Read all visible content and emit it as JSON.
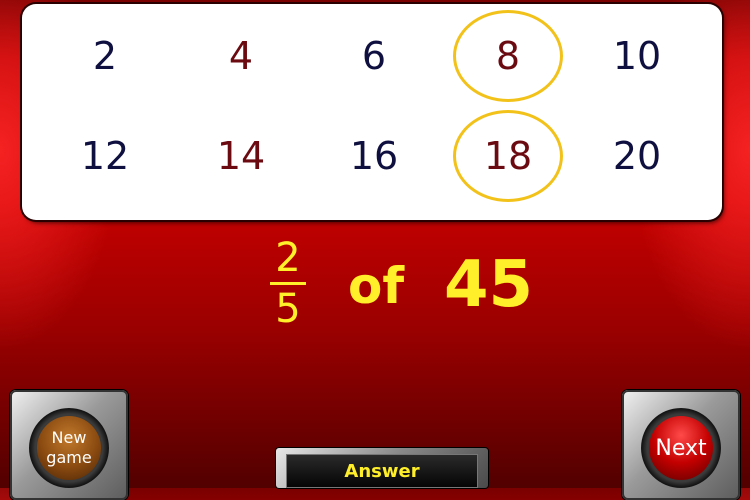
{
  "grid": {
    "cells": [
      {
        "value": "2",
        "color": "navy",
        "circled": false
      },
      {
        "value": "4",
        "color": "maroon",
        "circled": false
      },
      {
        "value": "6",
        "color": "navy",
        "circled": false
      },
      {
        "value": "8",
        "color": "maroon",
        "circled": true
      },
      {
        "value": "10",
        "color": "navy",
        "circled": false
      },
      {
        "value": "12",
        "color": "navy",
        "circled": false
      },
      {
        "value": "14",
        "color": "maroon",
        "circled": false
      },
      {
        "value": "16",
        "color": "navy",
        "circled": false
      },
      {
        "value": "18",
        "color": "maroon",
        "circled": true
      },
      {
        "value": "20",
        "color": "navy",
        "circled": false
      }
    ]
  },
  "question": {
    "numerator": "2",
    "denominator": "5",
    "of_word": "of",
    "number": "45"
  },
  "buttons": {
    "new_game_line1": "New",
    "new_game_line2": "game",
    "next": "Next",
    "answer": "Answer"
  },
  "colors": {
    "accent_yellow": "#ffef2a",
    "circle_gold": "#f2c21a",
    "number_navy": "#101040",
    "number_maroon": "#6b0a10"
  }
}
